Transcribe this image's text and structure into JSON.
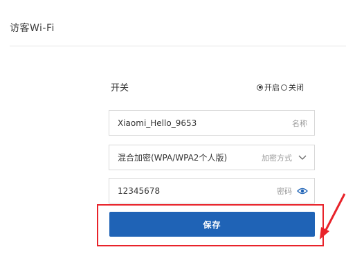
{
  "page": {
    "title": "访客Wi-Fi"
  },
  "switch": {
    "label": "开关",
    "options": [
      {
        "label": "开启",
        "selected": true
      },
      {
        "label": "关闭",
        "selected": false
      }
    ]
  },
  "fields": {
    "name": {
      "value": "Xiaomi_Hello_9653",
      "hint": "名称"
    },
    "encryption": {
      "value": "混合加密(WPA/WPA2个人版)",
      "hint": "加密方式",
      "icon": "chevron-down-icon"
    },
    "password": {
      "value": "12345678",
      "hint": "密码",
      "icon": "eye-icon"
    }
  },
  "save": {
    "label": "保存"
  },
  "colors": {
    "accent": "#1f63b6",
    "annotation": "#e8232a"
  }
}
